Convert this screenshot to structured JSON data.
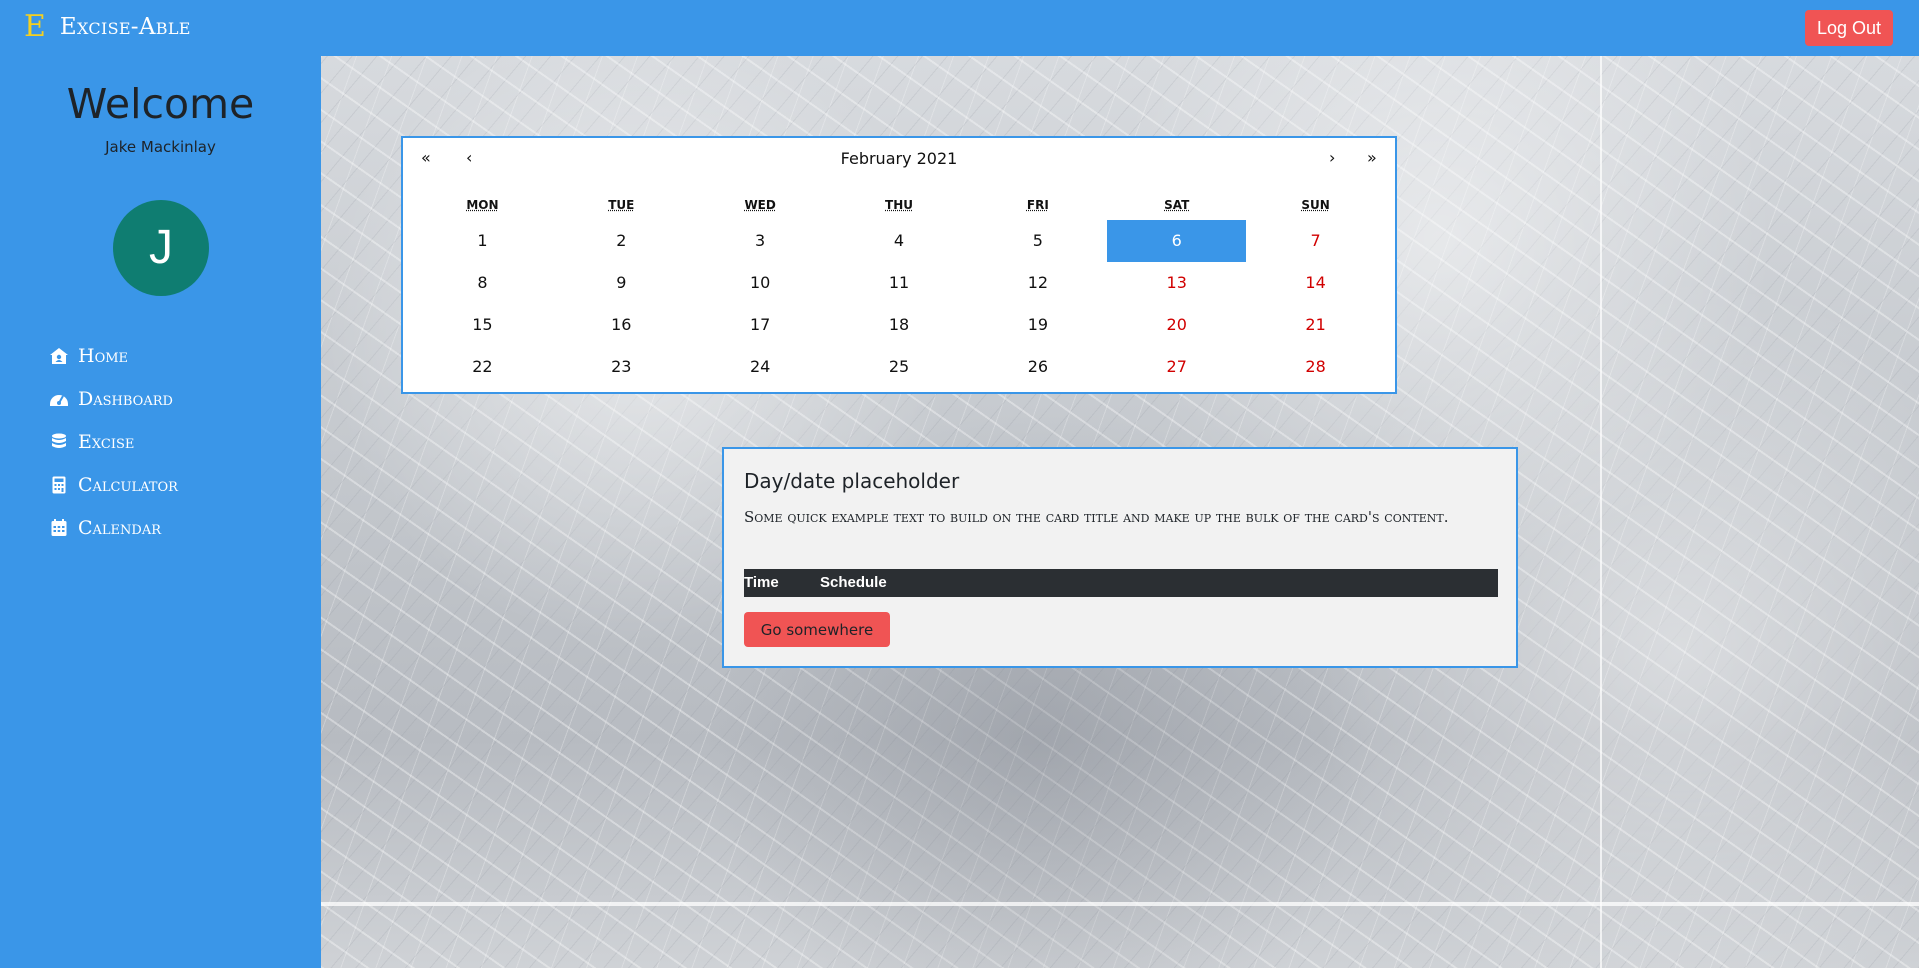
{
  "brand": {
    "logo_letter": "E",
    "name": "Excise-Able"
  },
  "header": {
    "logout_label": "Log Out"
  },
  "sidebar": {
    "welcome": "Welcome",
    "user_name": "Jake Mackinlay",
    "avatar_initial": "J",
    "items": [
      {
        "label": "Home",
        "icon": "home-icon"
      },
      {
        "label": "Dashboard",
        "icon": "dashboard-icon"
      },
      {
        "label": "Excise",
        "icon": "database-icon"
      },
      {
        "label": "Calculator",
        "icon": "calculator-icon"
      },
      {
        "label": "Calendar",
        "icon": "calendar-icon"
      }
    ]
  },
  "calendar": {
    "prev2": "«",
    "prev": "‹",
    "next": "›",
    "next2": "»",
    "month_label": "February 2021",
    "weekdays": [
      "MON",
      "TUE",
      "WED",
      "THU",
      "FRI",
      "SAT",
      "SUN"
    ],
    "weeks": [
      [
        "1",
        "2",
        "3",
        "4",
        "5",
        "6",
        "7"
      ],
      [
        "8",
        "9",
        "10",
        "11",
        "12",
        "13",
        "14"
      ],
      [
        "15",
        "16",
        "17",
        "18",
        "19",
        "20",
        "21"
      ],
      [
        "22",
        "23",
        "24",
        "25",
        "26",
        "27",
        "28"
      ]
    ],
    "selected": "6"
  },
  "card": {
    "title": "Day/date placeholder",
    "text": "Some quick example text to build on the card title and make up the bulk of the card's content.",
    "col_time": "Time",
    "col_schedule": "Schedule",
    "button_label": "Go somewhere"
  },
  "colors": {
    "primary": "#3a96e8",
    "danger": "#f05454",
    "avatar": "#0f7d71",
    "weekend": "#d10000",
    "logo": "#f5d020"
  }
}
